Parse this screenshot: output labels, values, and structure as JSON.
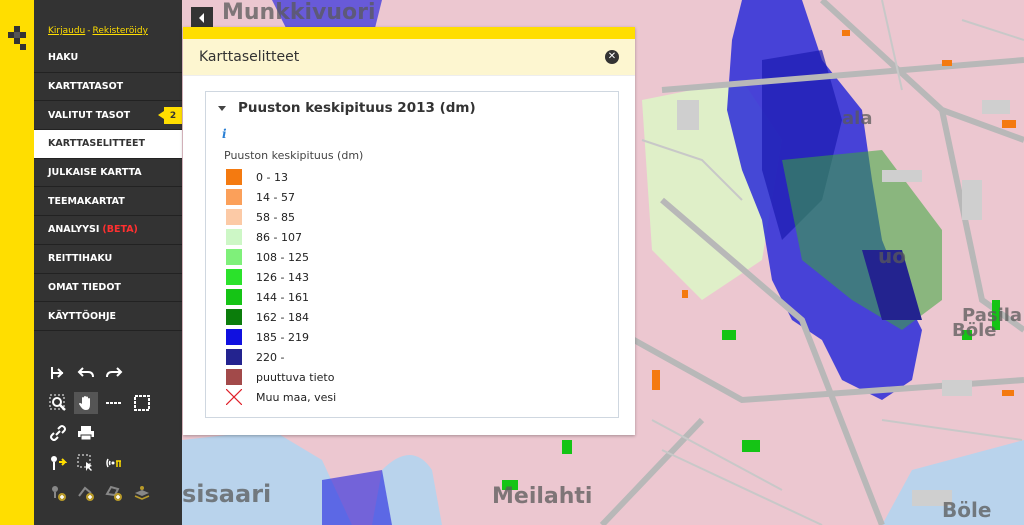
{
  "auth": {
    "login": "Kirjaudu",
    "separator": "-",
    "register": "Rekisteröidy"
  },
  "nav": [
    {
      "label": "HAKU"
    },
    {
      "label": "KARTTATASOT"
    },
    {
      "label": "VALITUT TASOT",
      "badge": "2"
    },
    {
      "label": "KARTTASELITTEET",
      "active": true
    },
    {
      "label": "JULKAISE KARTTA"
    },
    {
      "label": "TEEMAKARTAT"
    },
    {
      "label": "ANALYYSI",
      "beta": "(BETA)"
    },
    {
      "label": "REITTIHAKU"
    },
    {
      "label": "OMAT TIEDOT"
    },
    {
      "label": "KÄYTTÖOHJE"
    }
  ],
  "tools": {
    "row1": [
      "reset-view-icon",
      "undo-icon",
      "redo-icon"
    ],
    "row2": [
      "zoom-box-icon",
      "pan-hand-icon",
      "measure-line-icon",
      "measure-area-icon"
    ],
    "row3": [
      "link-icon",
      "print-icon"
    ],
    "row4": [
      "coordinate-tool-icon",
      "feature-select-icon",
      "gps-icon"
    ],
    "row5": [
      "add-point-icon",
      "add-line-icon",
      "add-area-icon",
      "add-layer-icon"
    ]
  },
  "panel": {
    "title": "Karttaselitteet",
    "layer_title": "Puuston keskipituus 2013 (dm)",
    "legend_title": "Puuston keskipituus (dm)",
    "legend": [
      {
        "label": "0 - 13",
        "color": "#f47a10"
      },
      {
        "label": "14 - 57",
        "color": "#fba05a"
      },
      {
        "label": "58 - 85",
        "color": "#fccaa6"
      },
      {
        "label": "86 - 107",
        "color": "#cdf7c6"
      },
      {
        "label": "108 - 125",
        "color": "#7ff07a"
      },
      {
        "label": "126 - 143",
        "color": "#2be22b"
      },
      {
        "label": "144 - 161",
        "color": "#15c415"
      },
      {
        "label": "162 - 184",
        "color": "#0b7d0b"
      },
      {
        "label": "185 - 219",
        "color": "#1010e0"
      },
      {
        "label": "220 -",
        "color": "#23238f"
      },
      {
        "label": "puuttuva tieto",
        "color": "#a24a4a"
      },
      {
        "label": "Muu maa, vesi",
        "symbol": "cross",
        "color": "#e0202a"
      }
    ]
  },
  "map": {
    "labels": [
      "Munkkivuori",
      "ala",
      "uo",
      "Pasila",
      "Böle",
      "sisaari",
      "Meilahti",
      "Böle"
    ]
  }
}
